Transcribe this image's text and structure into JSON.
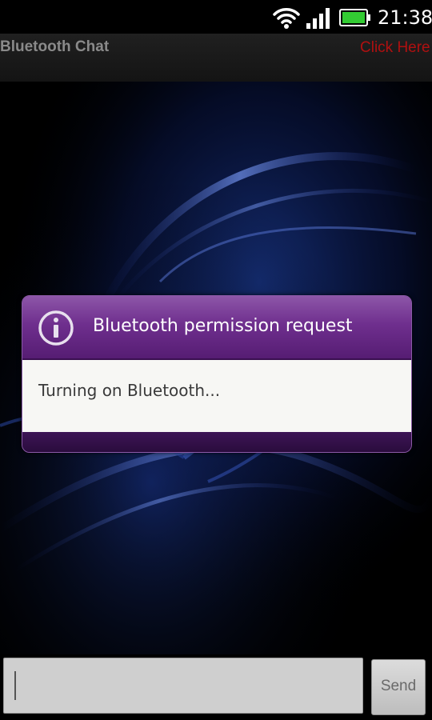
{
  "status_bar": {
    "time": "21:38",
    "icons": [
      "wifi-icon",
      "signal-icon",
      "battery-icon"
    ]
  },
  "app_bar": {
    "title": "Bluetooth Chat",
    "action_label": "Click Here"
  },
  "dialog": {
    "icon": "info-icon",
    "title": "Bluetooth permission request",
    "message": "Turning on Bluetooth..."
  },
  "compose": {
    "input_value": "",
    "send_label": "Send"
  },
  "colors": {
    "dialog_header": "#6f2f8e",
    "dialog_frame": "#3d1556",
    "action_text": "#b01010",
    "background": "#000000"
  }
}
